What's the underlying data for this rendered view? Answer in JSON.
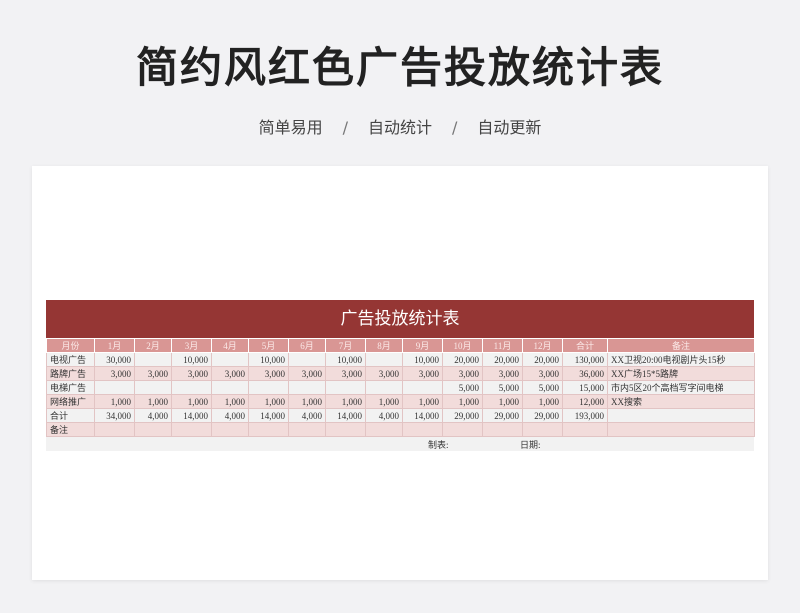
{
  "page": {
    "title": "简约风红色广告投放统计表",
    "subtitle": [
      "简单易用",
      "自动统计",
      "自动更新"
    ],
    "separator": "/"
  },
  "sheet": {
    "title": "广告投放统计表",
    "headers": [
      "月份",
      "1月",
      "2月",
      "3月",
      "4月",
      "5月",
      "6月",
      "7月",
      "8月",
      "9月",
      "10月",
      "11月",
      "12月",
      "合计",
      "备注"
    ],
    "rows": [
      [
        "电视广告",
        "30,000",
        "",
        "10,000",
        "",
        "10,000",
        "",
        "10,000",
        "",
        "10,000",
        "20,000",
        "20,000",
        "20,000",
        "130,000",
        "XX卫视20:00电视剧片头15秒"
      ],
      [
        "路牌广告",
        "3,000",
        "3,000",
        "3,000",
        "3,000",
        "3,000",
        "3,000",
        "3,000",
        "3,000",
        "3,000",
        "3,000",
        "3,000",
        "3,000",
        "36,000",
        "XX广场15*5路牌"
      ],
      [
        "电梯广告",
        "",
        "",
        "",
        "",
        "",
        "",
        "",
        "",
        "",
        "5,000",
        "5,000",
        "5,000",
        "15,000",
        "市内5区20个高档写字间电梯"
      ],
      [
        "网络推广",
        "1,000",
        "1,000",
        "1,000",
        "1,000",
        "1,000",
        "1,000",
        "1,000",
        "1,000",
        "1,000",
        "1,000",
        "1,000",
        "1,000",
        "12,000",
        "XX搜索"
      ],
      [
        "合计",
        "34,000",
        "4,000",
        "14,000",
        "4,000",
        "14,000",
        "4,000",
        "14,000",
        "4,000",
        "14,000",
        "29,000",
        "29,000",
        "29,000",
        "193,000",
        ""
      ],
      [
        "备注",
        "",
        "",
        "",
        "",
        "",
        "",
        "",
        "",
        "",
        "",
        "",
        "",
        "",
        ""
      ]
    ],
    "maker_label": "制表:",
    "date_label": "日期:"
  },
  "colors": {
    "title_bar": "#953634",
    "header_row": "#d99694",
    "row_pink": "#f2dcdb",
    "row_gray": "#f2f2f2"
  }
}
